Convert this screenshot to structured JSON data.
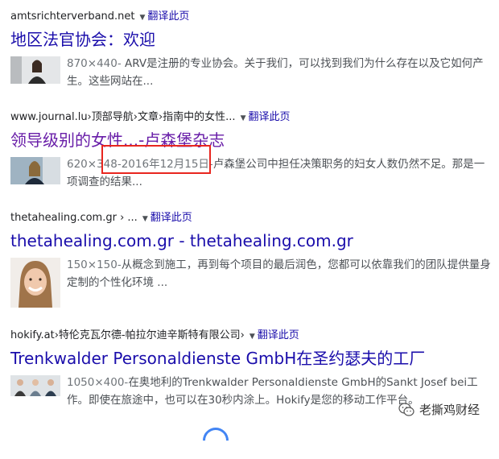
{
  "results": [
    {
      "cite": "amtsrichterverband.net",
      "translate": "翻译此页",
      "title": "地区法官协会：欢迎",
      "meta": "870×440-",
      "text": " ARV是注册的专业协会。关于我们，可以找到我们为什么存在以及它如何产生。这些网站在..."
    },
    {
      "cite": "www.journal.lu›顶部导航›文章›指南中的女性...",
      "translate": "翻译此页",
      "title": "领导级别的女性...-卢森堡杂志",
      "meta": "620×348-2016年12月15日-",
      "text": "卢森堡公司中担任决策职务的妇女人数仍然不足。那是一项调查的结果..."
    },
    {
      "cite": "thetahealing.com.gr › ...",
      "translate": "翻译此页",
      "title": "thetahealing.com.gr - thetahealing.com.gr",
      "meta": "150×150-",
      "text": "从概念到施工，再到每个项目的最后润色，您都可以依靠我们的团队提供量身定制的个性化环境 ..."
    },
    {
      "cite": "hokify.at›特伦克瓦尔德-帕拉尔迪辛斯特有限公司›",
      "translate": "翻译此页",
      "title": "Trenkwalder Personaldienste GmbH在圣约瑟夫的工厂",
      "meta": "1050×400-",
      "text": "在奥地利的Trenkwalder Personaldienste GmbH的Sankt Josef bei工作。即使在旅途中，也可以在30秒内涂上。Hokify是您的移动工作平台。"
    }
  ],
  "watermark": "老撕鸡财经",
  "colors": {
    "link": "#1a0dab",
    "visited": "#681da8",
    "highlight": "#e8261f"
  }
}
